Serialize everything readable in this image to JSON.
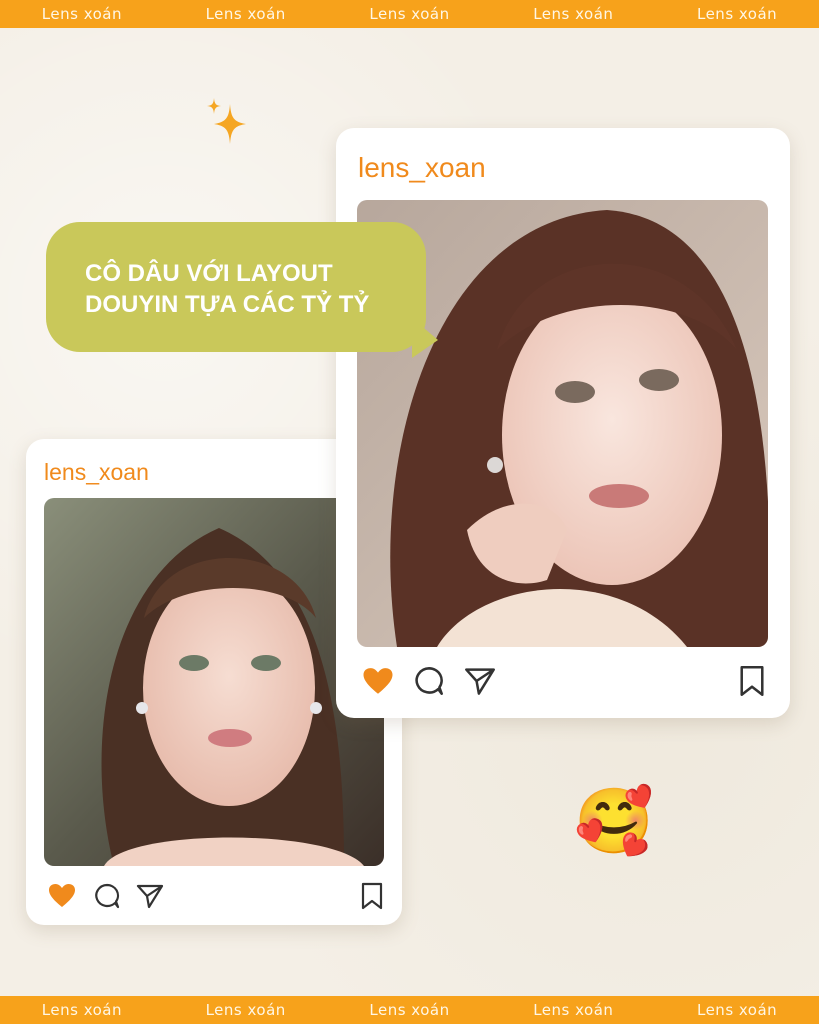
{
  "brand": {
    "name": "Lens xoán",
    "band_color": "#f7a21b"
  },
  "headline": {
    "line1": "CÔ DÂU VỚI LAYOUT",
    "line2": "DOUYIN TỰA CÁC TỶ TỶ",
    "bubble_color": "#c9c85a"
  },
  "post_main": {
    "username": "lens_xoan",
    "liked": true,
    "icons": [
      "heart-icon",
      "comment-icon",
      "share-icon",
      "bookmark-icon"
    ]
  },
  "post_secondary": {
    "username": "lens_xoan",
    "liked": true,
    "icons": [
      "heart-icon",
      "comment-icon",
      "share-icon",
      "bookmark-icon"
    ]
  },
  "decor": {
    "emoji": "🥰",
    "sparkle_color": "#f5a623",
    "accent_color": "#f08a1c"
  }
}
